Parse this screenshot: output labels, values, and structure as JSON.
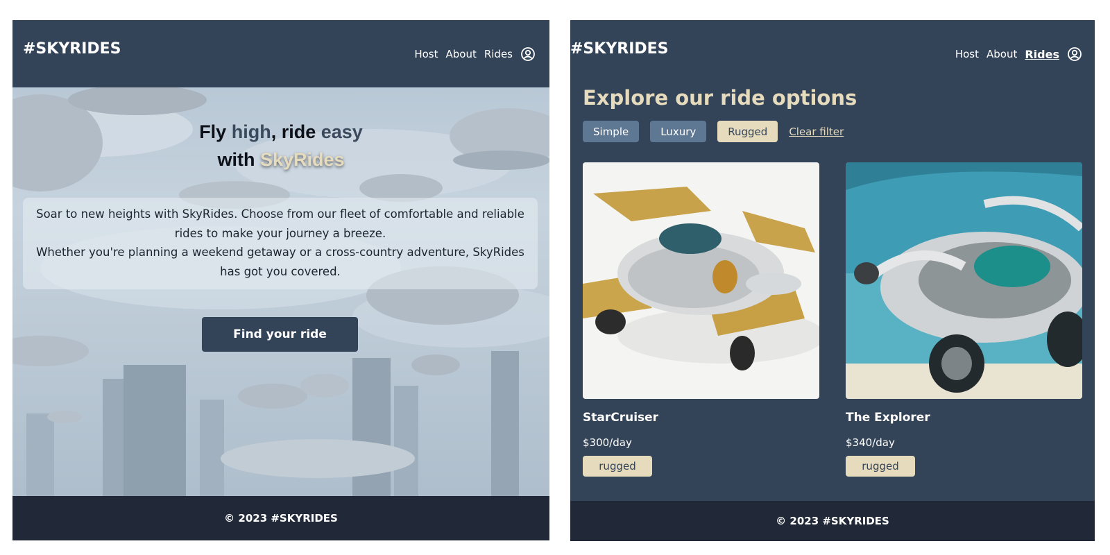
{
  "left": {
    "logo": "#SKYRIDES",
    "nav": {
      "host": "Host",
      "about": "About",
      "rides": "Rides",
      "account_icon": "user-circle-icon"
    },
    "hero": {
      "title_parts": [
        "Fly ",
        "high",
        ", ride ",
        "easy",
        "with ",
        "SkyRides"
      ],
      "description_line1": "Soar to new heights with SkyRides. Choose from our fleet of comfortable and reliable rides to make your journey a breeze.",
      "description_line2": "Whether you're planning a weekend getaway or a cross-country adventure, SkyRides has got you covered.",
      "cta_label": "Find your ride"
    },
    "footer": "© 2023 #SKYRIDES"
  },
  "right": {
    "logo": "#SKYRIDES",
    "nav": {
      "host": "Host",
      "about": "About",
      "rides": "Rides",
      "active": "Rides",
      "account_icon": "user-circle-icon"
    },
    "title": "Explore our ride options",
    "filters": [
      {
        "label": "Simple",
        "selected": false
      },
      {
        "label": "Luxury",
        "selected": false
      },
      {
        "label": "Rugged",
        "selected": true
      }
    ],
    "clear_filter": "Clear filter",
    "rides": [
      {
        "name": "StarCruiser",
        "price": "$300/day",
        "tag": "rugged"
      },
      {
        "name": "The Explorer",
        "price": "$340/day",
        "tag": "rugged"
      }
    ],
    "footer": "© 2023 #SKYRIDES"
  },
  "colors": {
    "navy": "#344458",
    "footer": "#212938",
    "gold": "#e6dbbd",
    "chip": "#5e7894"
  }
}
